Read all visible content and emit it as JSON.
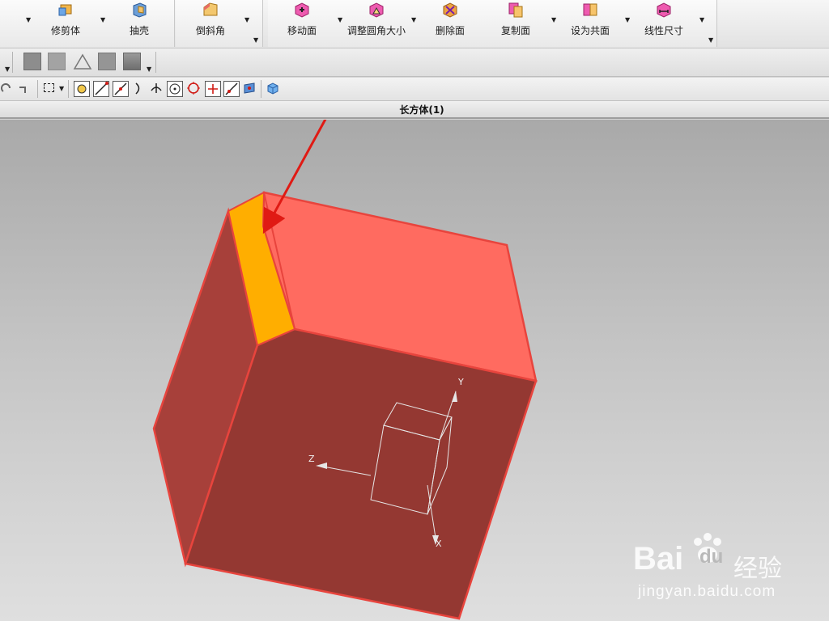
{
  "ribbon": {
    "buttons": [
      {
        "label": "修剪体"
      },
      {
        "label": "抽壳"
      },
      {
        "label": "倒斜角"
      },
      {
        "label": "移动面"
      },
      {
        "label": "调整圆角大小"
      },
      {
        "label": "删除面"
      },
      {
        "label": "复制面"
      },
      {
        "label": "设为共面"
      },
      {
        "label": "线性尺寸"
      }
    ]
  },
  "title_bar": {
    "text": "长方体(1)"
  },
  "viewport": {
    "axes": {
      "x": "X",
      "y": "Y",
      "z": "Z"
    },
    "colors": {
      "top_face": "#ff6b60",
      "front_face": "#943832",
      "left_face": "#a7403a",
      "chamfer_face": "#ffae00",
      "edge": "#e8443d",
      "arrow": "#e01a14"
    }
  },
  "watermark": {
    "brand_left": "Bai",
    "brand_right": "du",
    "brand_cn": "经验",
    "url": "jingyan.baidu.com"
  },
  "icons": [
    "move-face-icon",
    "resize-blend-icon",
    "delete-face-icon",
    "copy-face-icon",
    "make-coplanar-icon",
    "linear-dimension-icon",
    "trim-body-icon",
    "shell-icon",
    "chamfer-icon"
  ]
}
